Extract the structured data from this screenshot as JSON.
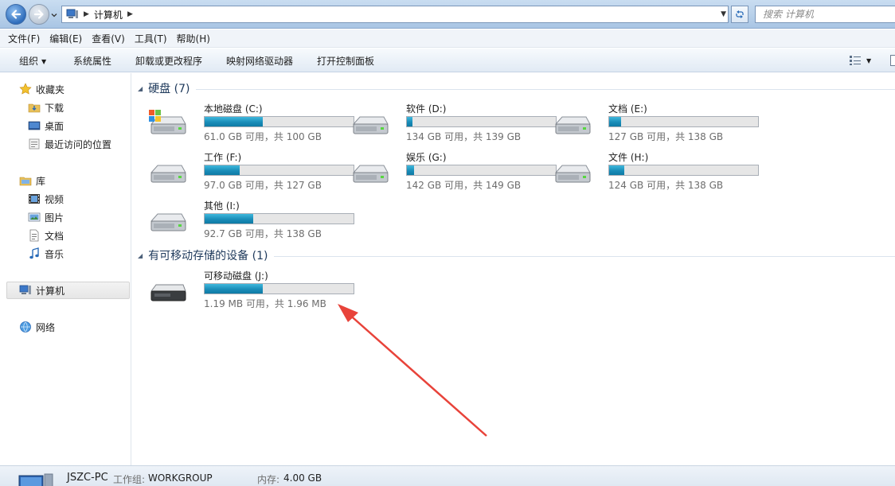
{
  "address": {
    "crumb": "计算机",
    "search_placeholder": "搜索 计算机"
  },
  "menu": [
    "文件(F)",
    "编辑(E)",
    "查看(V)",
    "工具(T)",
    "帮助(H)"
  ],
  "commands": {
    "organize": "组织",
    "system_properties": "系统属性",
    "uninstall": "卸载或更改程序",
    "map_drive": "映射网络驱动器",
    "control_panel": "打开控制面板"
  },
  "sidebar": {
    "favorites": {
      "label": "收藏夹",
      "items": [
        "下载",
        "桌面",
        "最近访问的位置"
      ]
    },
    "libraries": {
      "label": "库",
      "items": [
        "视频",
        "图片",
        "文档",
        "音乐"
      ]
    },
    "computer": "计算机",
    "network": "网络"
  },
  "groups": {
    "hard_disks": "硬盘 (7)",
    "removable": "有可移动存储的设备 (1)"
  },
  "drives": [
    {
      "name": "本地磁盘 (C:)",
      "info": "61.0 GB 可用，共 100 GB",
      "used_fraction": 0.39,
      "icon": "windows-drive-icon"
    },
    {
      "name": "软件 (D:)",
      "info": "134 GB 可用，共 139 GB",
      "used_fraction": 0.036,
      "icon": "hard-drive-icon"
    },
    {
      "name": "文档 (E:)",
      "info": "127 GB 可用，共 138 GB",
      "used_fraction": 0.08,
      "icon": "hard-drive-icon"
    },
    {
      "name": "工作 (F:)",
      "info": "97.0 GB 可用，共 127 GB",
      "used_fraction": 0.236,
      "icon": "hard-drive-icon"
    },
    {
      "name": "娱乐 (G:)",
      "info": "142 GB 可用，共 149 GB",
      "used_fraction": 0.047,
      "icon": "hard-drive-icon"
    },
    {
      "name": "文件 (H:)",
      "info": "124 GB 可用，共 138 GB",
      "used_fraction": 0.101,
      "icon": "hard-drive-icon"
    },
    {
      "name": "其他 (I:)",
      "info": "92.7 GB 可用，共 138 GB",
      "used_fraction": 0.328,
      "icon": "hard-drive-icon"
    }
  ],
  "removable_drives": [
    {
      "name": "可移动磁盘 (J:)",
      "info": "1.19 MB 可用，共 1.96 MB",
      "used_fraction": 0.393,
      "icon": "removable-drive-icon"
    }
  ],
  "status": {
    "pc_name": "JSZC-PC",
    "workgroup_label": "工作组:",
    "workgroup": "WORKGROUP",
    "memory_label": "内存:",
    "memory": "4.00 GB"
  },
  "colors": {
    "bar_fill": "#1a8db8",
    "arrow": "#e8433a"
  }
}
